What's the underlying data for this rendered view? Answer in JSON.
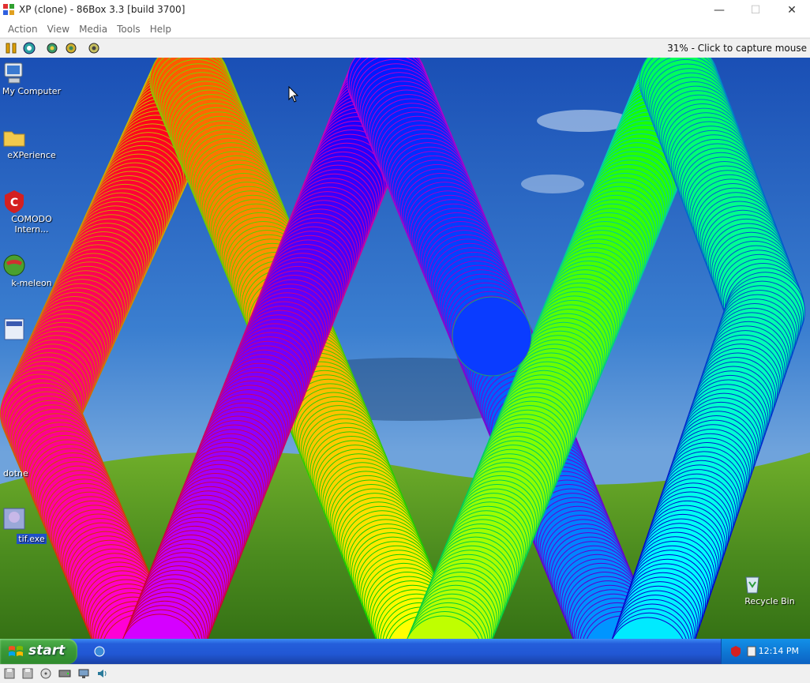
{
  "window": {
    "title": "XP (clone) - 86Box 3.3 [build 3700]",
    "minimize": "—",
    "maximize": "☐",
    "close": "✕"
  },
  "menu": [
    "Action",
    "View",
    "Media",
    "Tools",
    "Help"
  ],
  "toolbar": {
    "buttons": [
      "pause-icon",
      "ctrl-alt-del-icon",
      "settings-icon",
      "hard-reset-icon",
      "screenshot-icon"
    ],
    "capture_status": "31% - Click to capture mouse"
  },
  "desktop": {
    "icons": [
      {
        "label": "My Computer",
        "icon": "my-computer-icon"
      },
      {
        "label": "eXPerience",
        "icon": "folder-icon"
      },
      {
        "label": "COMODO Intern...",
        "icon": "comodo-icon"
      },
      {
        "label": "k-meleon",
        "icon": "k-meleon-icon"
      },
      {
        "label": "dotne",
        "icon": "dotnet-icon"
      },
      {
        "label": "tif.exe",
        "icon": "tif-exe-icon"
      },
      {
        "label": "Recycle Bin",
        "icon": "recycle-bin-icon"
      }
    ],
    "screensaver": "rainbow-ribbons"
  },
  "taskbar": {
    "start_label": "start",
    "clock": "12:14 PM"
  },
  "colors": {
    "taskbar_blue": "#245edb",
    "start_green": "#3c9a39",
    "sky": "#1f57b3",
    "grass": "#4a8a1e"
  }
}
